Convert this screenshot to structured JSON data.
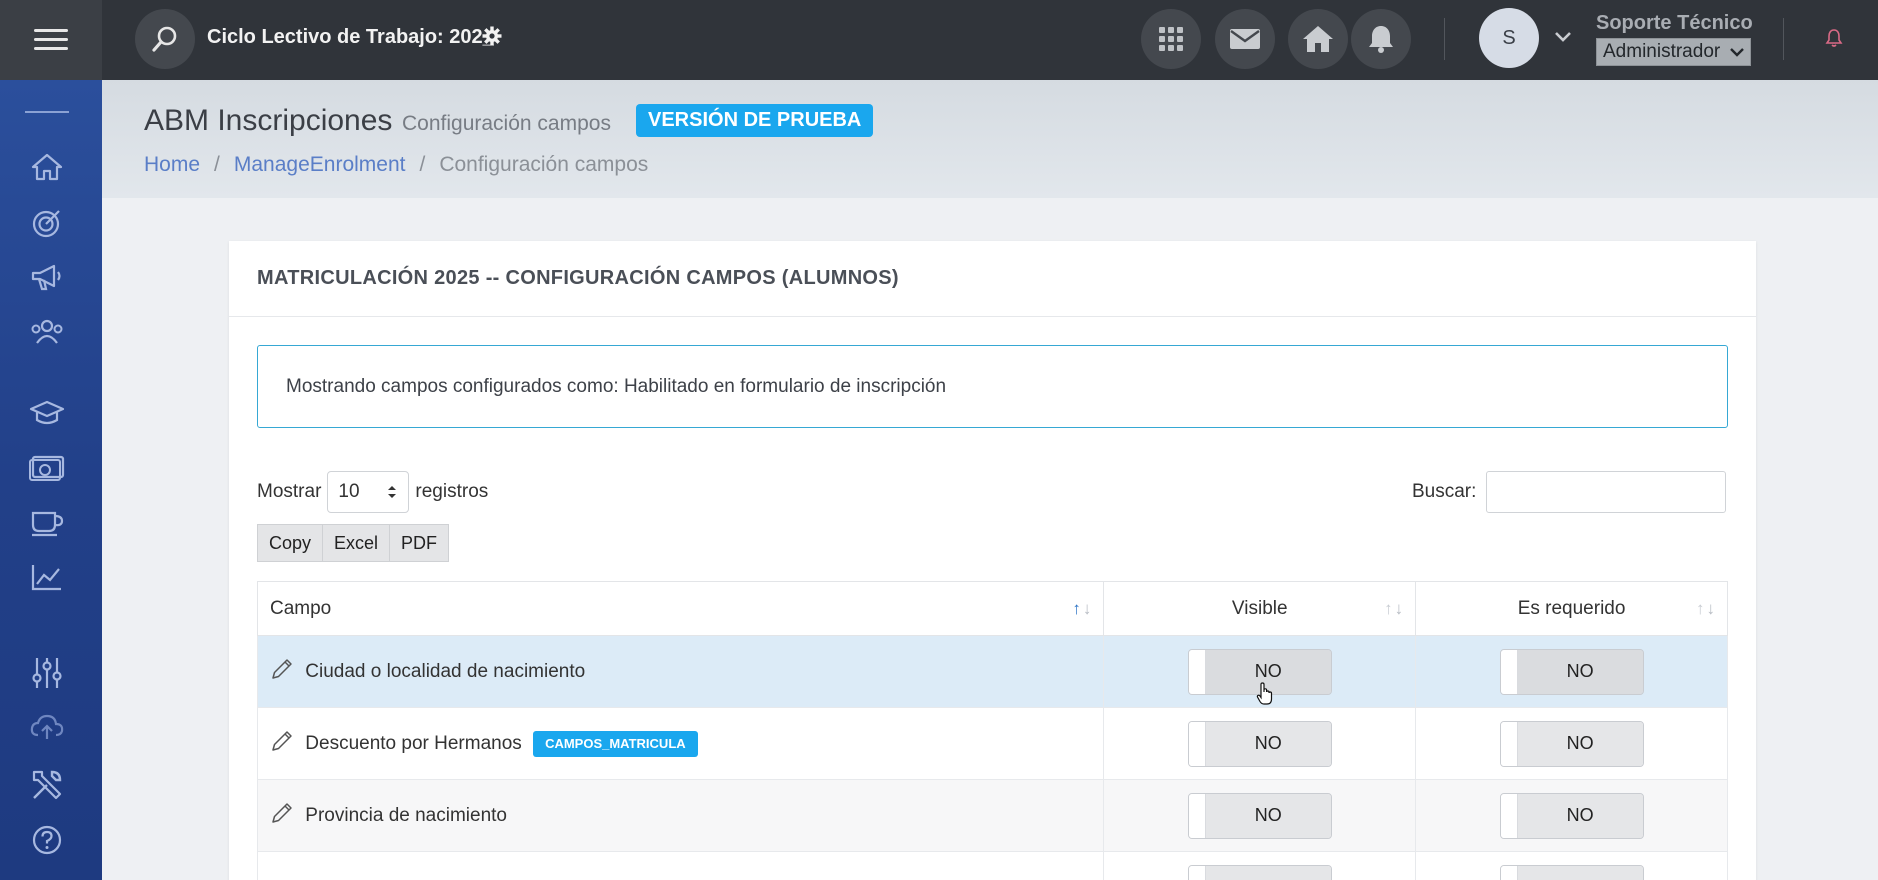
{
  "topbar": {
    "cycle_title": "Ciclo Lectivo de Trabajo: 202_",
    "user_name": "Soporte Técnico",
    "user_role": "Administrador",
    "avatar_initial": "S"
  },
  "icons": {
    "menu": "hamburger-icon",
    "search": "search-icon",
    "settings": "gear-icon",
    "apps": "grid-icon",
    "mail": "envelope-icon",
    "home": "home-icon",
    "notifications": "bell-icon"
  },
  "sidebar": {
    "items": [
      {
        "icon": "home-icon"
      },
      {
        "icon": "target-icon"
      },
      {
        "icon": "megaphone-icon"
      },
      {
        "icon": "users-icon"
      },
      {
        "icon": "graduation-cap-icon"
      },
      {
        "icon": "money-icon"
      },
      {
        "icon": "coffee-cup-icon"
      },
      {
        "icon": "line-chart-icon"
      },
      {
        "icon": "sliders-icon"
      },
      {
        "icon": "cloud-upload-icon"
      },
      {
        "icon": "tools-icon"
      },
      {
        "icon": "help-icon"
      }
    ]
  },
  "header": {
    "title": "ABM Inscripciones",
    "subtitle": "Configuración campos",
    "badge": "VERSIÓN DE PRUEBA",
    "breadcrumb": [
      "Home",
      "ManageEnrolment",
      "Configuración campos"
    ]
  },
  "card": {
    "title": "MATRICULACIÓN 2025 -- CONFIGURACIÓN CAMPOS (ALUMNOS)",
    "info": "Mostrando campos configurados como: Habilitado en formulario de inscripción",
    "length_prefix": "Mostrar",
    "length_value": "10",
    "length_suffix": "registros",
    "search_label": "Buscar:",
    "search_value": "",
    "export_buttons": [
      "Copy",
      "Excel",
      "PDF"
    ]
  },
  "table": {
    "headers": [
      "Campo",
      "Visible",
      "Es requerido"
    ],
    "rows": [
      {
        "campo": "Ciudad o localidad de nacimiento",
        "tag": "",
        "visible": "NO",
        "requerido": "NO"
      },
      {
        "campo": "Descuento por Hermanos",
        "tag": "CAMPOS_MATRICULA",
        "visible": "NO",
        "requerido": "NO"
      },
      {
        "campo": "Provincia de nacimiento",
        "tag": "",
        "visible": "NO",
        "requerido": "NO"
      }
    ]
  },
  "colors": {
    "topbar": "#30343a",
    "sidebar": "#224089",
    "accent": "#1aa7ee",
    "link": "#5a7ec7",
    "selected_row": "#dcebf7"
  }
}
